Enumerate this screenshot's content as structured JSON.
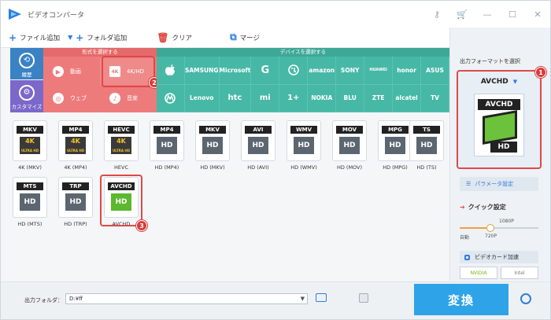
{
  "window": {
    "title": "ビデオコンバータ"
  },
  "toolbar": {
    "add_file": "ファイル追加",
    "add_folder": "フォルダ追加",
    "clear": "クリア",
    "merge": "マージ"
  },
  "categories": {
    "history": "履歴",
    "custom": "カスタマイズ",
    "format_header": "形式を選択する",
    "device_header": "デバイスを選択する",
    "formats": [
      {
        "label": "動画"
      },
      {
        "label": "4K/HD"
      },
      {
        "label": "ウェブ"
      },
      {
        "label": "音楽"
      }
    ],
    "devices_row1": [
      "",
      "SAMSUNG",
      "Microsoft",
      "G",
      "",
      "amazon",
      "SONY",
      "HUAWEI",
      "honor",
      "ASUS"
    ],
    "devices_row2": [
      "",
      "Lenovo",
      "htc",
      "mi",
      "1+",
      "NOKIA",
      "BLU",
      "ZTE",
      "alcatel",
      "TV"
    ]
  },
  "tiles": [
    {
      "ext": "MKV",
      "badge": "4K",
      "label": "4K (MKV)"
    },
    {
      "ext": "MP4",
      "badge": "4K",
      "label": "4K (MP4)"
    },
    {
      "ext": "HEVC",
      "badge": "4K",
      "label": "HEVC"
    },
    {
      "ext": "MP4",
      "badge": "HD",
      "label": "HD (MP4)"
    },
    {
      "ext": "MKV",
      "badge": "HD",
      "label": "HD (MKV)"
    },
    {
      "ext": "AVI",
      "badge": "HD",
      "label": "HD (AVI)"
    },
    {
      "ext": "WMV",
      "badge": "HD",
      "label": "HD (WMV)"
    },
    {
      "ext": "MOV",
      "badge": "HD",
      "label": "HD (MOV)"
    },
    {
      "ext": "MPG",
      "badge": "HD",
      "label": "HD (MPG)"
    },
    {
      "ext": "TS",
      "badge": "HD",
      "label": "HD (TS)"
    },
    {
      "ext": "MTS",
      "badge": "HD",
      "label": "HD (MTS)"
    },
    {
      "ext": "TRP",
      "badge": "HD",
      "label": "HD (TRP)"
    },
    {
      "ext": "AVCHD",
      "badge": "HD",
      "label": "AVCHD"
    }
  ],
  "tile_badges": {
    "ultra": "ULTRA HD"
  },
  "markers": [
    "1",
    "2",
    "3"
  ],
  "right_panel": {
    "header": "出力フォーマットを選択",
    "selected_format": "AVCHD",
    "icon_top": "AVCHD",
    "icon_bottom": "HD",
    "params_button": "パラメータ設定",
    "quick_settings": "クイック設定",
    "slider_top_label": "1080P",
    "slider_left_label": "自動",
    "slider_mid_label": "720P",
    "gpu_accel": "ビデオカード加速",
    "gpu_nvidia": "NVIDIA",
    "gpu_intel": "Intel"
  },
  "bottom": {
    "output_folder_label": "出力フォルダ：",
    "output_path": "D:¥ff",
    "convert_button": "変換"
  }
}
